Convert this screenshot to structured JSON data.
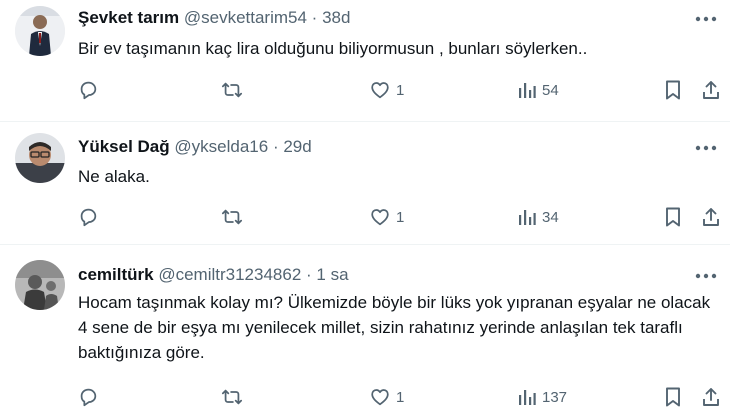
{
  "tweets": [
    {
      "name": "Şevket tarım",
      "handle": "@sevkettarim54",
      "sep": "·",
      "time": "38d",
      "text": "Bir ev taşımanın kaç lira olduğunu biliyormusun , bunları söylerken..",
      "likes": "1",
      "views": "54"
    },
    {
      "name": "Yüksel Dağ",
      "handle": "@ykselda16",
      "sep": "·",
      "time": "29d",
      "text": "Ne alaka.",
      "likes": "1",
      "views": "34"
    },
    {
      "name": "cemiltürk",
      "handle": "@cemiltr31234862",
      "sep": "·",
      "time": "1 sa",
      "text": "Hocam taşınmak kolay mı? Ülkemizde böyle bir lüks yok yıpranan eşyalar ne olacak 4 sene de bir eşya mı yenilecek millet, sizin rahatınız yerinde anlaşılan tek taraflı baktığınıza göre.",
      "likes": "1",
      "views": "137"
    }
  ],
  "icons": {
    "more": "more-horizontal-icon",
    "reply": "reply-icon",
    "retweet": "retweet-icon",
    "like": "heart-icon",
    "views": "views-chart-icon",
    "bookmark": "bookmark-icon",
    "share": "share-icon"
  },
  "colors": {
    "text": "#0f1419",
    "secondary": "#536471",
    "divider": "#eff3f4"
  }
}
